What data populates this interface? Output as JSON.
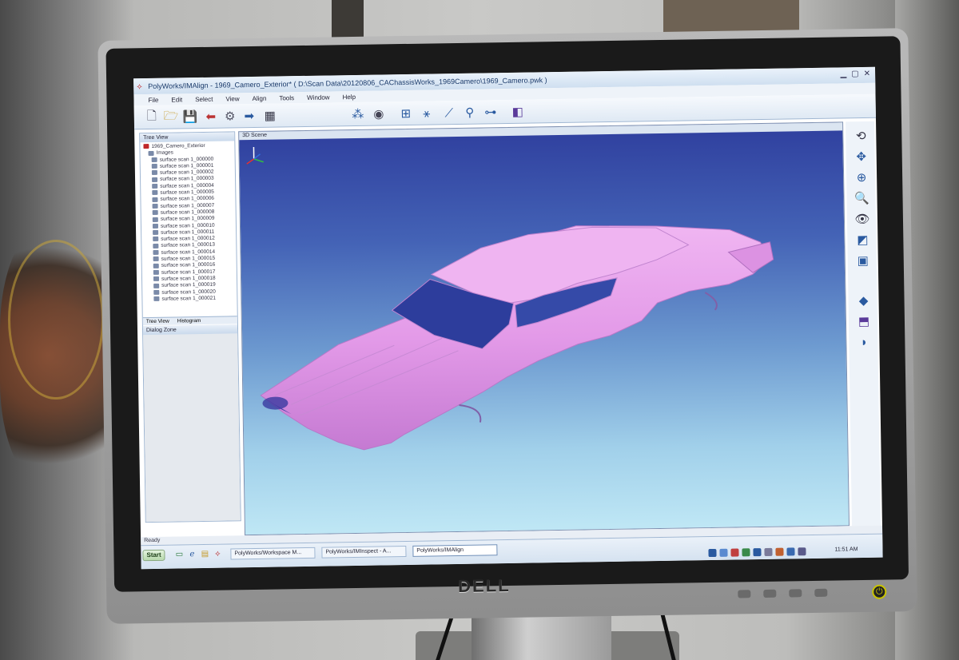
{
  "window": {
    "title": "PolyWorks/IMAlign - 1969_Camero_Exterior* ( D:\\Scan Data\\20120806_CAChassisWorks_1969Camero\\1969_Camero.pwk )"
  },
  "menu": [
    "File",
    "Edit",
    "Select",
    "View",
    "Align",
    "Tools",
    "Window",
    "Help"
  ],
  "tree_view": {
    "header": "Tree View",
    "root": "1969_Camero_Exterior",
    "images_label": "Images",
    "items": [
      "surface scan 1_000000",
      "surface scan 1_000001",
      "surface scan 1_000002",
      "surface scan 1_000003",
      "surface scan 1_000004",
      "surface scan 1_000005",
      "surface scan 1_000006",
      "surface scan 1_000007",
      "surface scan 1_000008",
      "surface scan 1_000009",
      "surface scan 1_000010",
      "surface scan 1_000011",
      "surface scan 1_000012",
      "surface scan 1_000013",
      "surface scan 1_000014",
      "surface scan 1_000015",
      "surface scan 1_000016",
      "surface scan 1_000017",
      "surface scan 1_000018",
      "surface scan 1_000019",
      "surface scan 1_000020",
      "surface scan 1_000021"
    ],
    "tabs": [
      "Tree View",
      "Histogram"
    ]
  },
  "dialog_zone": {
    "header": "Dialog Zone"
  },
  "scene": {
    "header": "3D Scene",
    "model_color": "#e39ae8"
  },
  "statusbar": {
    "text": "Ready"
  },
  "taskbar": {
    "start_label": "Start",
    "tasks": [
      "PolyWorks/Workspace M...",
      "PolyWorks/IMInspect - A...",
      "PolyWorks/IMAlign"
    ],
    "clock": "11:51 AM"
  },
  "monitor": {
    "brand": "DELL"
  }
}
